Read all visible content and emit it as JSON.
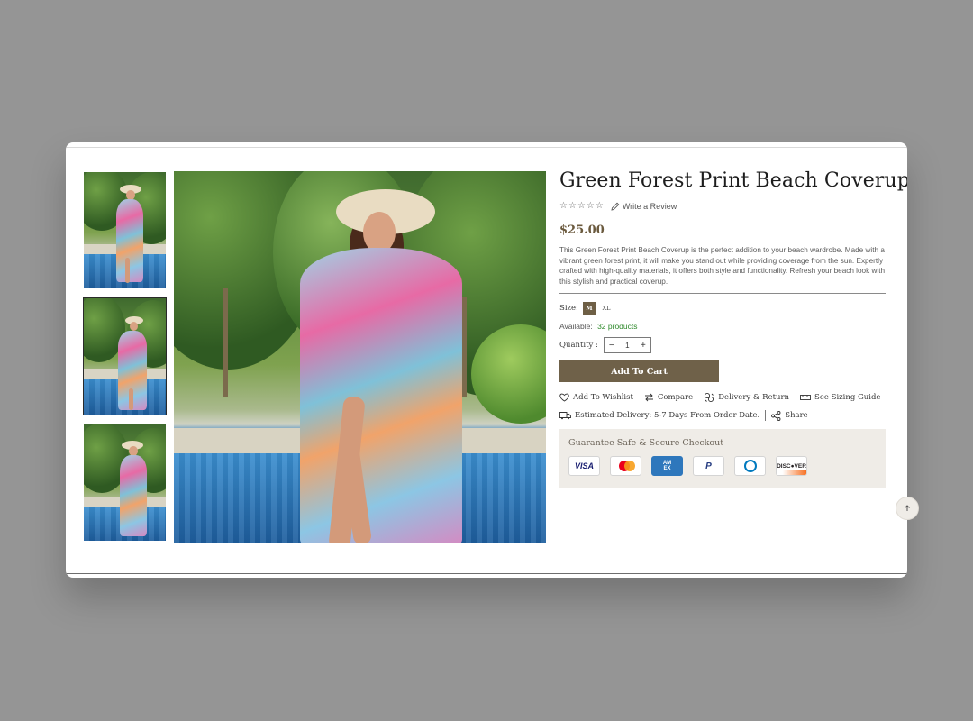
{
  "product": {
    "title": "Green Forest Print Beach Coverup",
    "rating_stars": 5,
    "write_review_label": "Write a Review",
    "price": "$25.00",
    "description": "This Green Forest Print Beach Coverup is the perfect addition to your beach wardrobe. Made with a vibrant green forest print, it will make you stand out while providing coverage from the sun. Expertly crafted with high-quality materials, it offers both style and functionality. Refresh your beach look with this stylish and practical coverup.",
    "size_label": "Size:",
    "sizes": [
      "M",
      "XL"
    ],
    "selected_size": "M",
    "available_label": "Available:",
    "available_count": "32 products",
    "quantity_label": "Quantity :",
    "quantity_value": "1",
    "qty_minus": "−",
    "qty_plus": "+",
    "add_to_cart": "Add To Cart"
  },
  "actions": {
    "wishlist": "Add To Wishlist",
    "compare": "Compare",
    "delivery": "Delivery & Return",
    "sizing": "See Sizing Guide",
    "estimated": "Estimated Delivery: 5-7 Days From Order Date.",
    "share": "Share"
  },
  "checkout": {
    "title": "Guarantee Safe & Secure Checkout",
    "cards": [
      "VISA",
      "Mastercard",
      "AMEX",
      "PayPal",
      "Diners Club",
      "DISCOVER"
    ],
    "visa_text": "VISA",
    "amex_text_1": "AM",
    "amex_text_2": "EX",
    "paypal_text": "P",
    "discover_text": "DISC●VER"
  },
  "gallery": {
    "thumbnails": 3,
    "active_thumbnail": 1
  },
  "colors": {
    "accent": "#6f6149",
    "available_green": "#2f8a2c",
    "checkout_bg": "#efece7"
  }
}
